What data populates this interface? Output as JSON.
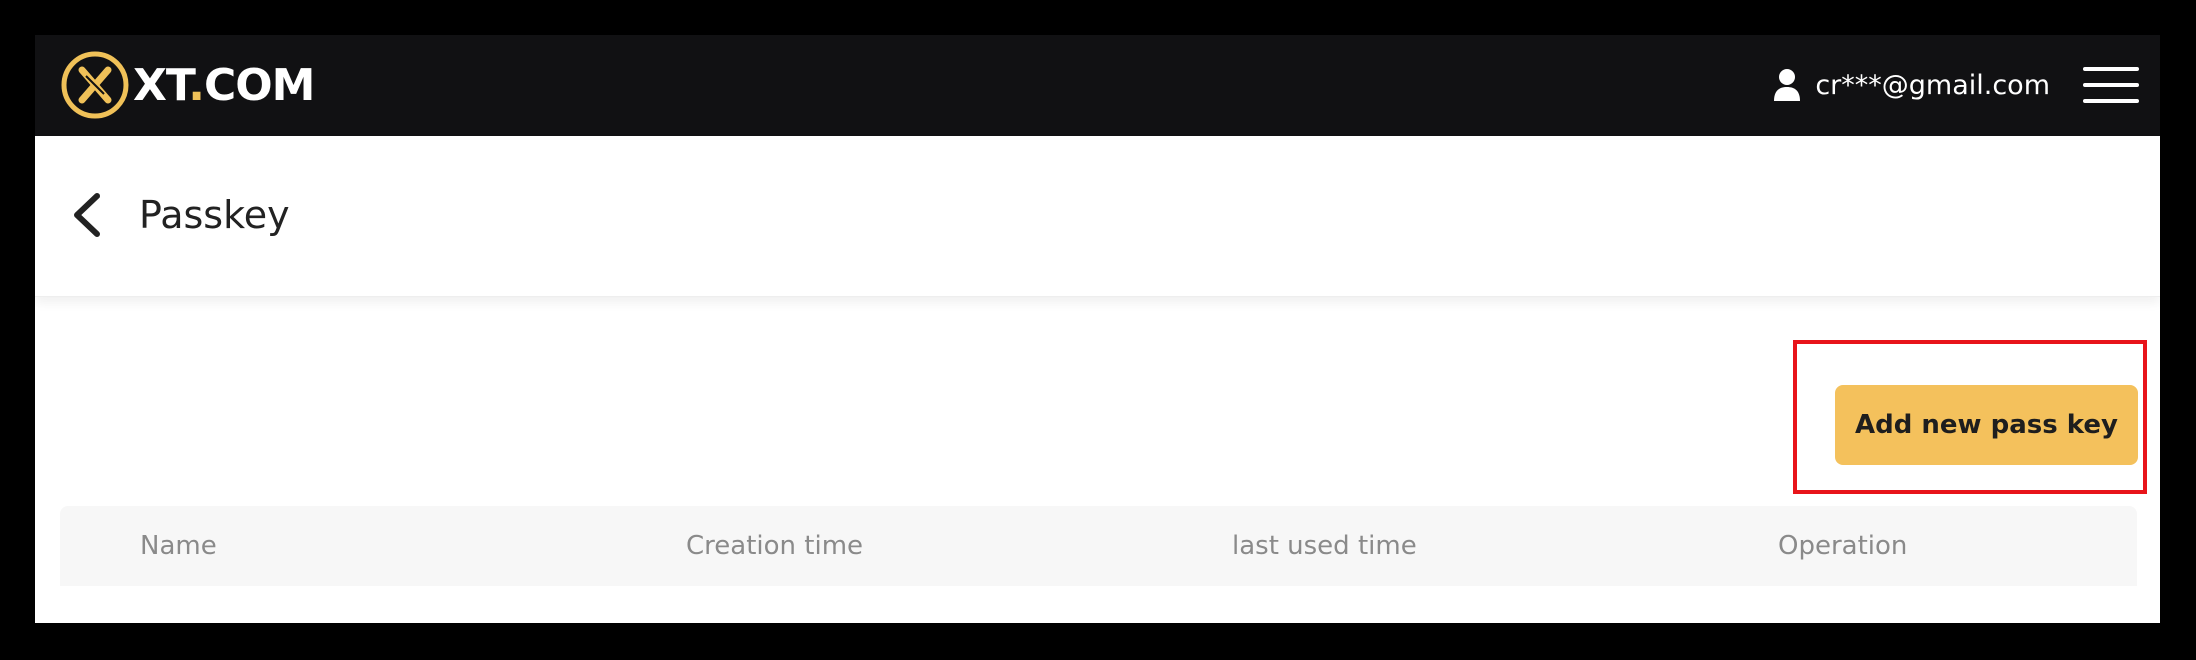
{
  "header": {
    "logo_text_main": "XT",
    "logo_text_dot": ".",
    "logo_text_suffix": "COM",
    "user_email": "cr***@gmail.com",
    "icons": {
      "logo": "xt-logo-icon",
      "user": "user-icon",
      "menu": "menu-icon"
    }
  },
  "page": {
    "title": "Passkey",
    "back_icon": "chevron-left-icon"
  },
  "actions": {
    "add_button_label": "Add new pass key"
  },
  "table": {
    "columns": [
      "Name",
      "Creation time",
      "last used time",
      "Operation"
    ],
    "rows": []
  },
  "colors": {
    "background": "#000000",
    "topbar": "#111113",
    "accent": "#f4c15c",
    "highlight_border": "#e8141a",
    "table_header_bg": "#f7f7f7",
    "table_header_text": "#8a8a8a"
  }
}
